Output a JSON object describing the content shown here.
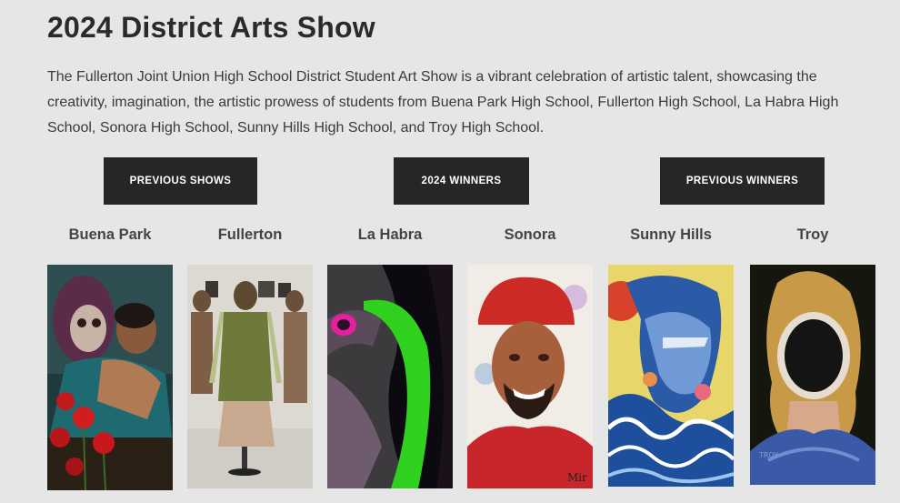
{
  "page": {
    "title": "2024 District Arts Show",
    "intro": "The Fullerton Joint Union High School District Student Art Show is a vibrant celebration of artistic talent, showcasing the creativity, imagination, the artistic prowess of students from Buena Park High School, Fullerton High School, La Habra High School, Sonora High School, Sunny Hills High School, and Troy High School."
  },
  "buttons": {
    "previous_shows": "PREVIOUS SHOWS",
    "winners_2024": "2024 WINNERS",
    "previous_winners": "PREVIOUS WINNERS"
  },
  "schools": [
    {
      "name": "Buena Park"
    },
    {
      "name": "Fullerton"
    },
    {
      "name": "La Habra"
    },
    {
      "name": "Sonora"
    },
    {
      "name": "Sunny Hills"
    },
    {
      "name": "Troy"
    }
  ],
  "artwork_signatures": {
    "sonora": "Mir",
    "troy": "TROY"
  }
}
